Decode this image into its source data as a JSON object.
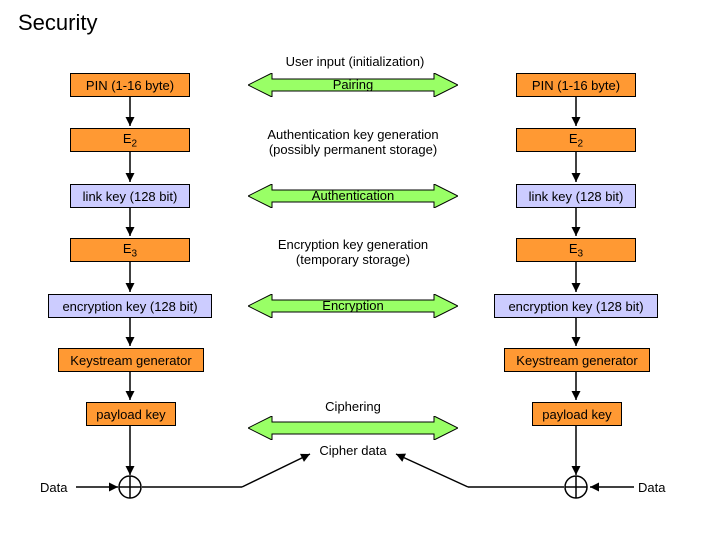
{
  "title": "Security",
  "top_center": "User input (initialization)",
  "left": {
    "pin": "PIN (1-16 byte)",
    "e2": "E",
    "e2_sub": "2",
    "linkkey": "link key (128 bit)",
    "e3": "E",
    "e3_sub": "3",
    "enckey": "encryption key (128 bit)",
    "keystream": "Keystream generator",
    "payload": "payload key",
    "data": "Data"
  },
  "right": {
    "pin": "PIN (1-16 byte)",
    "e2": "E",
    "e2_sub": "2",
    "linkkey": "link key (128 bit)",
    "e3": "E",
    "e3_sub": "3",
    "enckey": "encryption key (128 bit)",
    "keystream": "Keystream generator",
    "payload": "payload key",
    "data": "Data"
  },
  "center": {
    "pairing": "Pairing",
    "authgen": "Authentication key generation\n(possibly permanent storage)",
    "auth": "Authentication",
    "encgen": "Encryption key generation\n(temporary storage)",
    "encryption": "Encryption",
    "ciphering": "Ciphering",
    "cipherdata": "Cipher data"
  }
}
